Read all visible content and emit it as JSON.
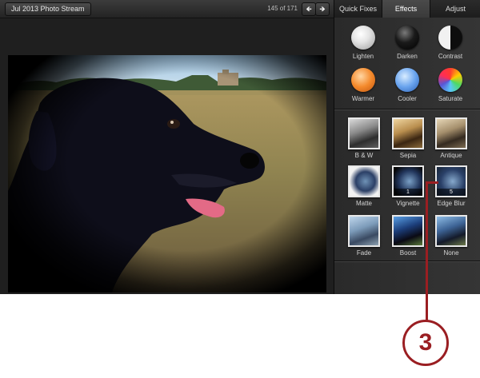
{
  "toolbar": {
    "album_label": "Jul 2013 Photo Stream",
    "counter": "145 of 171",
    "prev_icon": "left-arrow-icon",
    "next_icon": "right-arrow-icon"
  },
  "panel": {
    "tabs": [
      {
        "label": "Quick Fixes",
        "selected": false
      },
      {
        "label": "Effects",
        "selected": true
      },
      {
        "label": "Adjust",
        "selected": false
      }
    ],
    "swatches": [
      {
        "label": "Lighten",
        "icon": "lighten-swatch-icon"
      },
      {
        "label": "Darken",
        "icon": "darken-swatch-icon"
      },
      {
        "label": "Contrast",
        "icon": "contrast-swatch-icon"
      },
      {
        "label": "Warmer",
        "icon": "warmer-swatch-icon"
      },
      {
        "label": "Cooler",
        "icon": "cooler-swatch-icon"
      },
      {
        "label": "Saturate",
        "icon": "saturate-swatch-icon"
      }
    ],
    "effects": [
      {
        "label": "B & W",
        "badge": ""
      },
      {
        "label": "Sepia",
        "badge": ""
      },
      {
        "label": "Antique",
        "badge": ""
      },
      {
        "label": "Matte",
        "badge": ""
      },
      {
        "label": "Vignette",
        "badge": "1"
      },
      {
        "label": "Edge Blur",
        "badge": "5"
      },
      {
        "label": "Fade",
        "badge": ""
      },
      {
        "label": "Boost",
        "badge": ""
      },
      {
        "label": "None",
        "badge": ""
      }
    ]
  },
  "callout": {
    "number": "3"
  },
  "colors": {
    "callout": "#9a1e22",
    "selected_tab": "#3a3a3a"
  }
}
